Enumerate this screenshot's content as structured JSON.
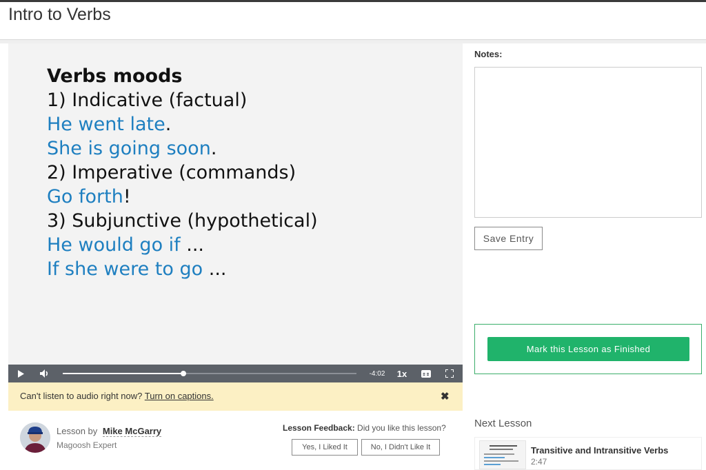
{
  "page": {
    "title": "Intro to Verbs"
  },
  "slide": {
    "heading": "Verbs moods",
    "lines": [
      {
        "prefix": "",
        "text": "1) Indicative (factual)",
        "suffix": ""
      },
      {
        "prefix": "He went late",
        "text": "",
        "suffix": "."
      },
      {
        "prefix": "She is going soon",
        "text": "",
        "suffix": "."
      },
      {
        "prefix": "",
        "text": "2) Imperative (commands)",
        "suffix": ""
      },
      {
        "prefix": "Go forth",
        "text": "",
        "suffix": "!"
      },
      {
        "prefix": "",
        "text": "3) Subjunctive (hypothetical)",
        "suffix": ""
      },
      {
        "prefix": "He would go if",
        "text": "",
        "suffix": " ..."
      },
      {
        "prefix": "If she were to go",
        "text": "",
        "suffix": " ..."
      }
    ]
  },
  "player": {
    "time_remaining": "-4:02",
    "speed": "1x",
    "progress": 0.41,
    "icons": {
      "play": "play-icon",
      "volume": "volume-icon",
      "captions": "captions-icon",
      "fullscreen": "fullscreen-icon"
    }
  },
  "caption_bar": {
    "text": "Can't listen to audio right now?",
    "link": "Turn on captions.",
    "close": "✖"
  },
  "author": {
    "prefix": "Lesson by",
    "name": "Mike McGarry",
    "role": "Magoosh Expert"
  },
  "feedback": {
    "label": "Lesson Feedback:",
    "question": "Did you like this lesson?",
    "yes": "Yes, I Liked It",
    "no": "No, I Didn't Like It"
  },
  "notes": {
    "label": "Notes:",
    "value": "",
    "save_label": "Save Entry"
  },
  "finish": {
    "label": "Mark this Lesson as Finished",
    "color": "#20b36b"
  },
  "next_lesson": {
    "label": "Next Lesson",
    "title": "Transitive and Intransitive Verbs",
    "duration": "2:47"
  },
  "colors": {
    "accent_green": "#20b36b",
    "slide_blue": "#1e7fc0",
    "caption_bg": "#fcf0c4",
    "controls_bg": "#5c6168"
  }
}
